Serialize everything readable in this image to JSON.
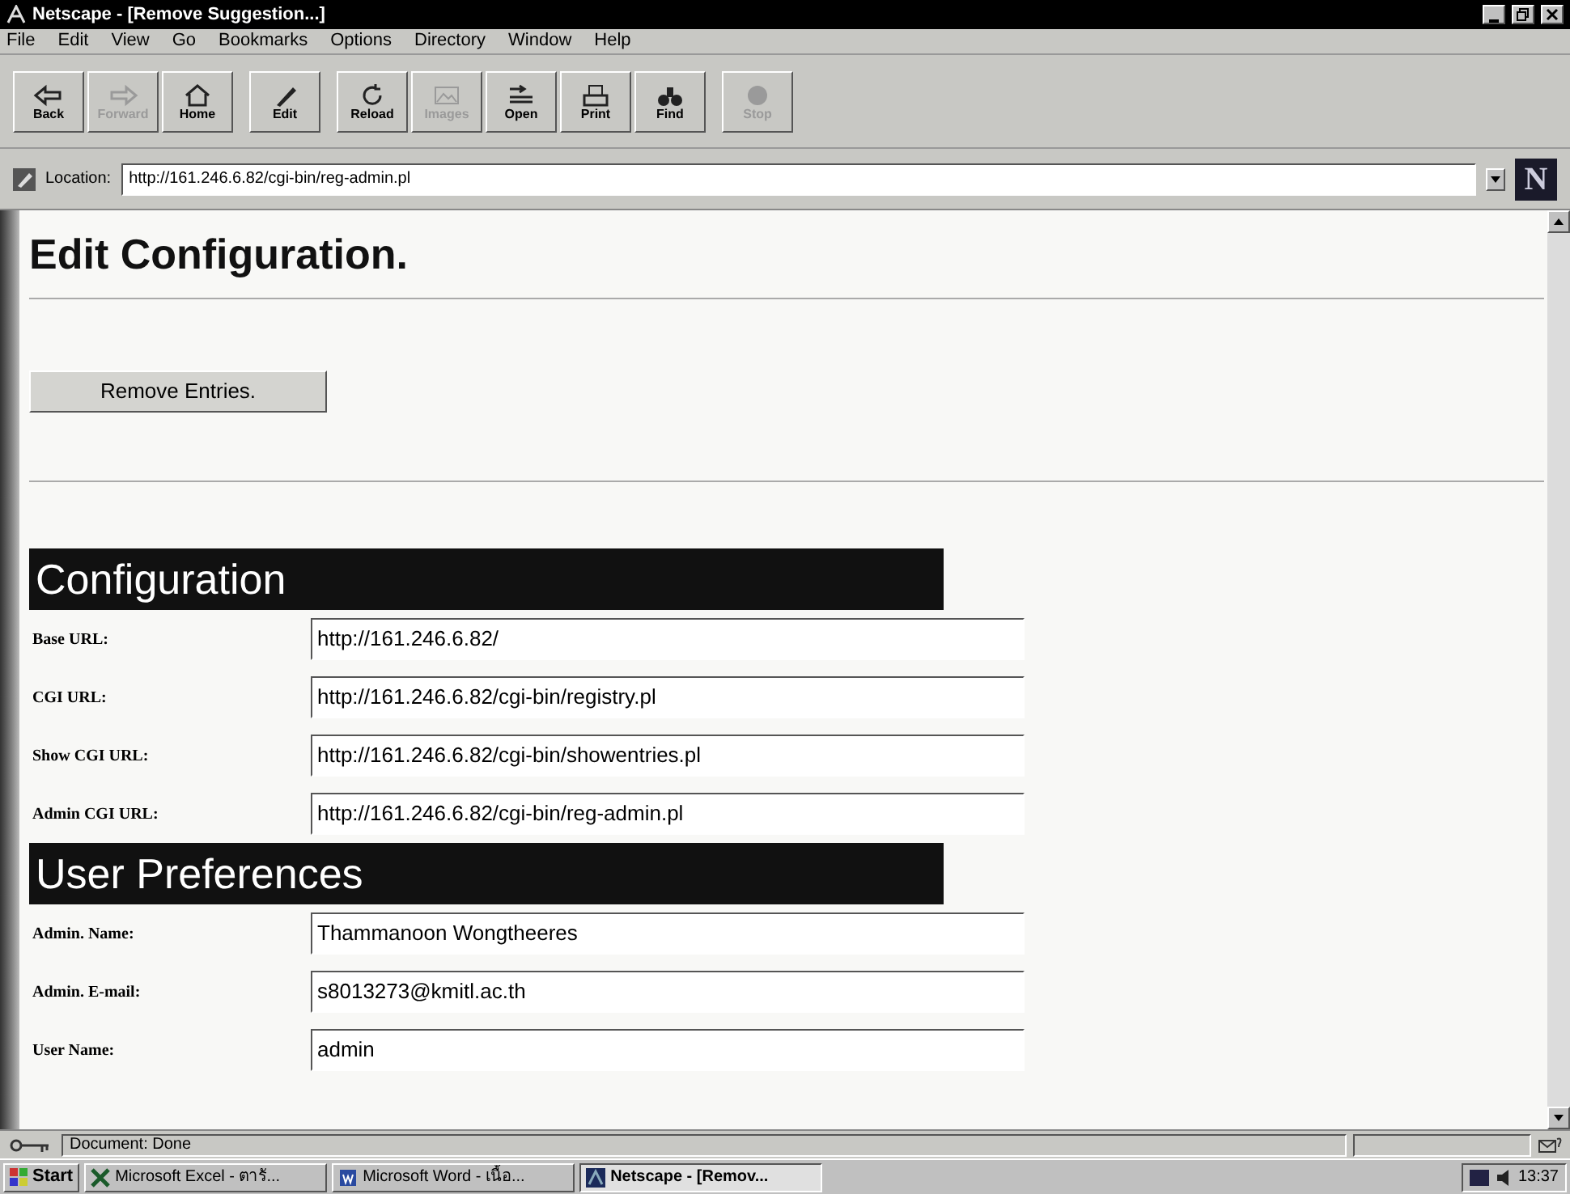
{
  "window": {
    "title": "Netscape - [Remove Suggestion...]"
  },
  "menu": [
    "File",
    "Edit",
    "View",
    "Go",
    "Bookmarks",
    "Options",
    "Directory",
    "Window",
    "Help"
  ],
  "toolbar": [
    {
      "label": "Back",
      "kind": "back",
      "disabled": false
    },
    {
      "label": "Forward",
      "kind": "forward",
      "disabled": true
    },
    {
      "label": "Home",
      "kind": "home",
      "disabled": false
    },
    {
      "label": "Edit",
      "kind": "edit",
      "disabled": false
    },
    {
      "label": "Reload",
      "kind": "reload",
      "disabled": false
    },
    {
      "label": "Images",
      "kind": "images",
      "disabled": true
    },
    {
      "label": "Open",
      "kind": "open",
      "disabled": false
    },
    {
      "label": "Print",
      "kind": "print",
      "disabled": false
    },
    {
      "label": "Find",
      "kind": "find",
      "disabled": false
    },
    {
      "label": "Stop",
      "kind": "stop",
      "disabled": true
    }
  ],
  "location": {
    "label": "Location:",
    "value": "http://161.246.6.82/cgi-bin/reg-admin.pl"
  },
  "brand_letter": "N",
  "page": {
    "title": "Edit Configuration.",
    "button": "Remove Entries.",
    "sections": [
      {
        "heading": "Configuration",
        "fields": [
          {
            "label": "Base URL:",
            "value": "http://161.246.6.82/"
          },
          {
            "label": "CGI URL:",
            "value": "http://161.246.6.82/cgi-bin/registry.pl"
          },
          {
            "label": "Show CGI URL:",
            "value": "http://161.246.6.82/cgi-bin/showentries.pl"
          },
          {
            "label": "Admin CGI URL:",
            "value": "http://161.246.6.82/cgi-bin/reg-admin.pl"
          }
        ]
      },
      {
        "heading": "User Preferences",
        "fields": [
          {
            "label": "Admin. Name:",
            "value": "Thammanoon Wongtheeres"
          },
          {
            "label": "Admin. E-mail:",
            "value": "s8013273@kmitl.ac.th"
          },
          {
            "label": "User Name:",
            "value": "admin"
          }
        ]
      }
    ]
  },
  "status_bar": {
    "text": "Document: Done"
  },
  "taskbar": {
    "start": "Start",
    "tasks": [
      {
        "label": "Microsoft Excel - ตารั...",
        "kind": "excel",
        "selected": false
      },
      {
        "label": "Microsoft Word - เนื้อ...",
        "kind": "word",
        "selected": false
      },
      {
        "label": "Netscape - [Remov...",
        "kind": "netscape",
        "selected": true
      }
    ],
    "clock": "13:37"
  }
}
